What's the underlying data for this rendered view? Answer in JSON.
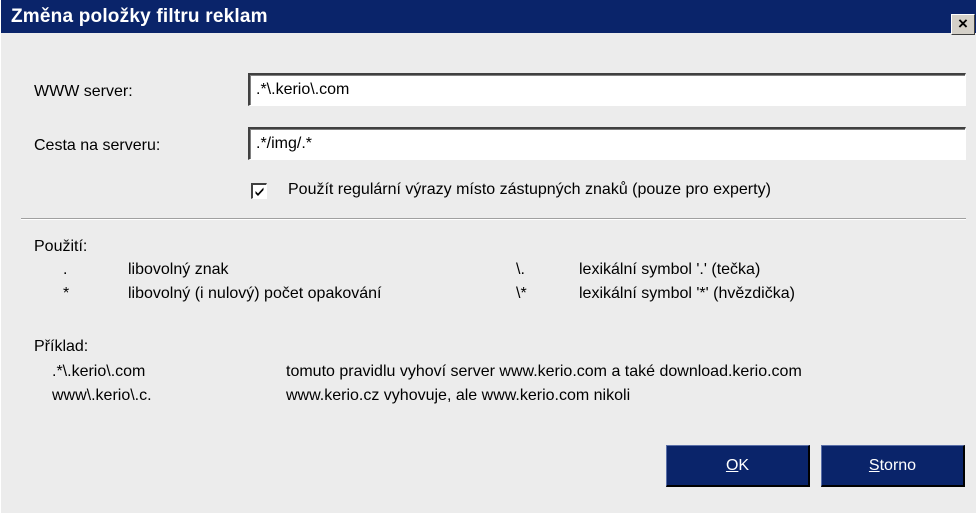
{
  "dialog": {
    "title": "Změna položky filtru reklam",
    "close_label": "×"
  },
  "form": {
    "server_label": "WWW server:",
    "server_value": ".*\\.kerio\\.com",
    "path_label": "Cesta na serveru:",
    "path_value": ".*/img/.*",
    "regex_checkbox_label": "Použít regulární výrazy místo zástupných znaků (pouze pro experty)",
    "regex_checked": true
  },
  "usage": {
    "heading": "Použití:",
    "rows": [
      {
        "sym": ".",
        "desc": "libovolný znak",
        "sym2": "\\.",
        "desc2": "lexikální symbol '.' (tečka)"
      },
      {
        "sym": "*",
        "desc": "libovolný (i nulový) počet opakování",
        "sym2": "\\*",
        "desc2": "lexikální symbol '*' (hvězdička)"
      }
    ]
  },
  "example": {
    "heading": "Příklad:",
    "rows": [
      {
        "pattern": ".*\\.kerio\\.com",
        "desc": "tomuto pravidlu vyhoví server www.kerio.com a také download.kerio.com"
      },
      {
        "pattern": "www\\.kerio\\.c.",
        "desc": "www.kerio.cz vyhovuje, ale www.kerio.com nikoli"
      }
    ]
  },
  "buttons": {
    "ok_mnemonic": "O",
    "ok_rest": "K",
    "cancel_mnemonic": "S",
    "cancel_rest": "torno"
  }
}
